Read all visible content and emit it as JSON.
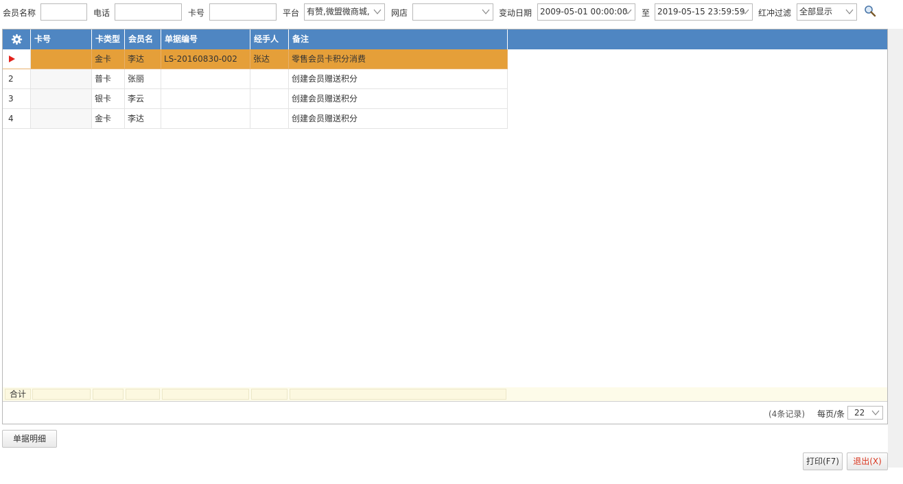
{
  "filters": {
    "member_name_label": "会员名称",
    "member_name_value": "",
    "phone_label": "电话",
    "phone_value": "",
    "card_no_label": "卡号",
    "card_no_value": "",
    "platform_label": "平台",
    "platform_value": "有赞,微盟微商城,",
    "shop_label": "网店",
    "shop_value": "",
    "date_label": "变动日期",
    "date_from": "2009-05-01 00:00:00",
    "date_to_label": "至",
    "date_to": "2019-05-15 23:59:59",
    "reversal_label": "红冲过滤",
    "reversal_value": "全部显示"
  },
  "grid": {
    "columns": [
      "卡号",
      "卡类型",
      "会员名",
      "单据编号",
      "经手人",
      "备注"
    ],
    "rows": [
      {
        "index": "",
        "card_no": "",
        "card_type": "金卡",
        "member": "李达",
        "doc_no": "LS-20160830-002",
        "handler": "张达",
        "remark": "零售会员卡积分消费",
        "selected": true
      },
      {
        "index": "2",
        "card_no": "",
        "card_type": "普卡",
        "member": "张丽",
        "doc_no": "",
        "handler": "",
        "remark": "创建会员赠送积分",
        "selected": false
      },
      {
        "index": "3",
        "card_no": "",
        "card_type": "银卡",
        "member": "李云",
        "doc_no": "",
        "handler": "",
        "remark": "创建会员赠送积分",
        "selected": false
      },
      {
        "index": "4",
        "card_no": "",
        "card_type": "金卡",
        "member": "李达",
        "doc_no": "",
        "handler": "",
        "remark": "创建会员赠送积分",
        "selected": false
      }
    ],
    "summary_label": "合计",
    "record_count": "(4条记录)",
    "per_page_label": "每页/条",
    "per_page_value": "22"
  },
  "buttons": {
    "detail": "单据明细",
    "print": "打印(F7)",
    "exit": "退出(X)"
  },
  "colors": {
    "header_bg": "#4f86c2",
    "selected_row": "#e59f39",
    "exit_text": "#d9361f"
  }
}
